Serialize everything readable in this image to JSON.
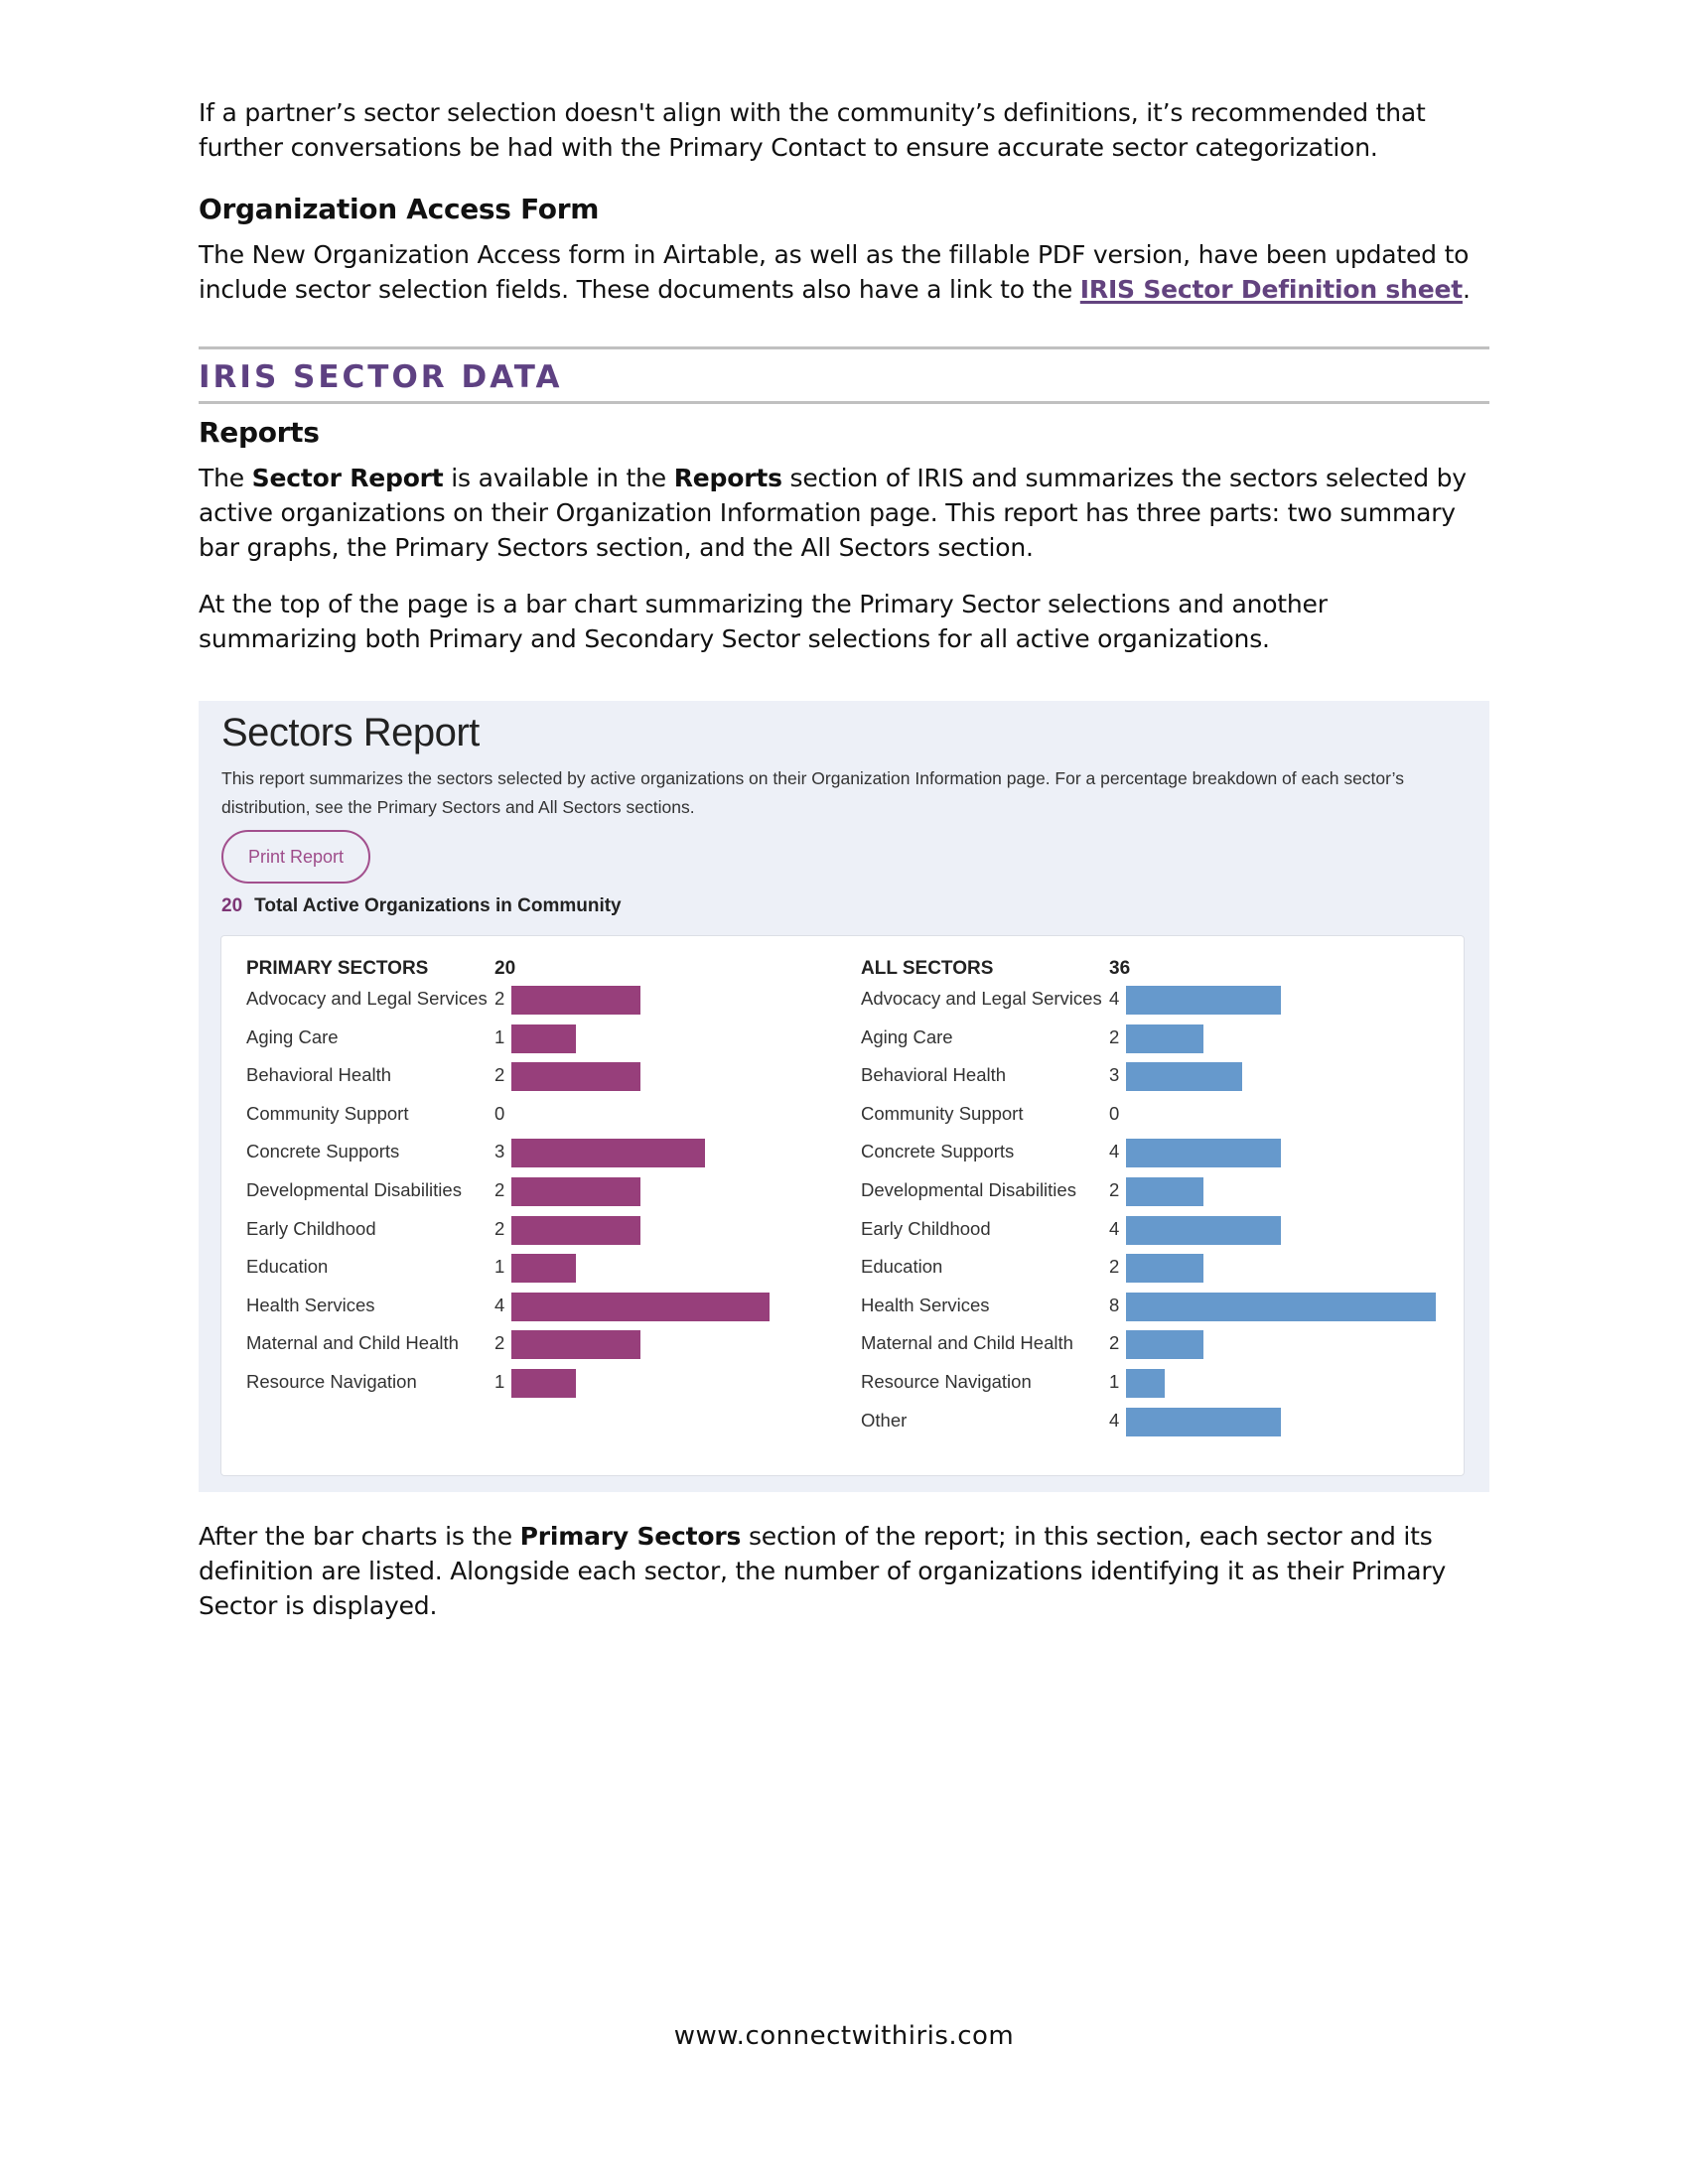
{
  "intro_paragraph": "If a partner’s sector selection doesn't align with the community’s definitions, it’s recommended that further conversations be had with the Primary Contact to ensure accurate sector categorization.",
  "access_form": {
    "heading": "Organization Access Form",
    "text_before_link": "The New Organization Access form in Airtable, as well as the fillable PDF version, have been updated to include sector selection fields. These documents also have a link to the ",
    "link_text": "IRIS Sector Definition sheet",
    "text_after_link": "."
  },
  "section": {
    "title": "IRIS SECTOR DATA",
    "reports_heading": "Reports",
    "p1": {
      "a": "The ",
      "b1": "Sector Report",
      "c": " is available in the ",
      "b2": "Reports",
      "d": " section of IRIS and summarizes the sectors selected by active organizations on their Organization Information page. This report has three parts: two summary bar graphs, the Primary Sectors section, and the All Sectors section."
    },
    "p2": "At the top of the page is a bar chart summarizing the Primary Sector selections and another summarizing both Primary and Secondary Sector selections for all active organizations.",
    "p3": {
      "a": "After the bar charts is the ",
      "b": "Primary Sectors",
      "c": " section of the report; in this section, each sector and its definition are listed. Alongside each sector, the number of organizations identifying it as their Primary Sector is displayed."
    }
  },
  "report": {
    "title": "Sectors Report",
    "description": "This report summarizes the sectors selected by active organizations on their Organization Information page. For a percentage breakdown of each sector’s distribution, see the Primary Sectors and All Sectors sections.",
    "print_button": "Print Report",
    "total_count": "20",
    "total_label": "Total Active Organizations in Community"
  },
  "colors": {
    "primary_bar": "#973f7b",
    "all_bar": "#6699cc",
    "accent_purple": "#5e4182"
  },
  "chart_data": [
    {
      "type": "bar",
      "orientation": "horizontal",
      "title": "PRIMARY SECTORS",
      "total": "20",
      "categories": [
        "Advocacy and Legal Services",
        "Aging Care",
        "Behavioral Health",
        "Community Support",
        "Concrete Supports",
        "Developmental Disabilities",
        "Early Childhood",
        "Education",
        "Health Services",
        "Maternal and Child Health",
        "Resource Navigation"
      ],
      "values": [
        2,
        1,
        2,
        0,
        3,
        2,
        2,
        1,
        4,
        2,
        1
      ],
      "xlim": [
        0,
        4
      ],
      "grid": false,
      "legend": "none"
    },
    {
      "type": "bar",
      "orientation": "horizontal",
      "title": "ALL SECTORS",
      "total": "36",
      "categories": [
        "Advocacy and Legal Services",
        "Aging Care",
        "Behavioral Health",
        "Community Support",
        "Concrete Supports",
        "Developmental Disabilities",
        "Early Childhood",
        "Education",
        "Health Services",
        "Maternal and Child Health",
        "Resource Navigation",
        "Other"
      ],
      "values": [
        4,
        2,
        3,
        0,
        4,
        2,
        4,
        2,
        8,
        2,
        1,
        4
      ],
      "xlim": [
        0,
        8
      ],
      "grid": false,
      "legend": "none"
    }
  ],
  "footer": "www.connectwithiris.com"
}
